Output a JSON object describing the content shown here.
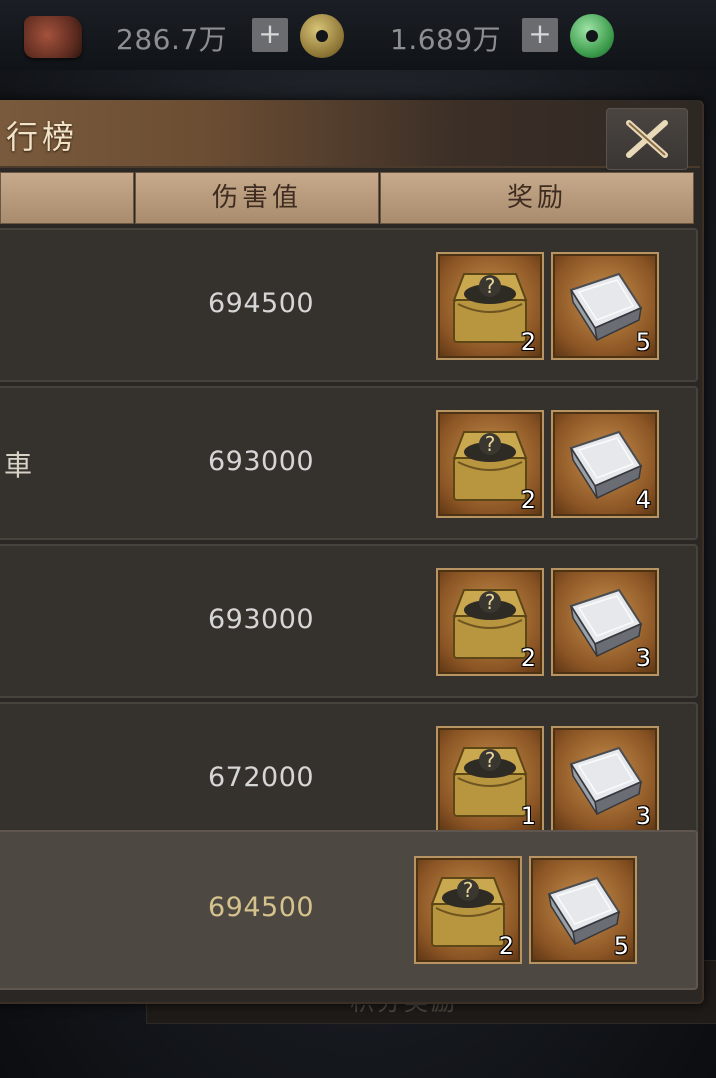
{
  "currency": {
    "copper": {
      "value": "286.7万",
      "icon": "copper-coin-icon"
    },
    "jade": {
      "value": "1.689万",
      "icon": "jade-coin-icon"
    },
    "plus_label": "+"
  },
  "panel": {
    "title": "行榜",
    "close_icon": "close-x-icon",
    "columns": {
      "damage": "伤害值",
      "reward": "奖励"
    },
    "footer_tab": "积分奖励"
  },
  "rankings": [
    {
      "name": "",
      "damage": "694500",
      "rewards": [
        {
          "icon": "treasure-chest-icon",
          "qty": "2"
        },
        {
          "icon": "silver-ingot-icon",
          "qty": "5"
        }
      ]
    },
    {
      "name": "車",
      "damage": "693000",
      "rewards": [
        {
          "icon": "treasure-chest-icon",
          "qty": "2"
        },
        {
          "icon": "silver-ingot-icon",
          "qty": "4"
        }
      ]
    },
    {
      "name": "",
      "damage": "693000",
      "rewards": [
        {
          "icon": "treasure-chest-icon",
          "qty": "2"
        },
        {
          "icon": "silver-ingot-icon",
          "qty": "3"
        }
      ]
    },
    {
      "name": "",
      "damage": "672000",
      "rewards": [
        {
          "icon": "treasure-chest-icon",
          "qty": "1"
        },
        {
          "icon": "silver-ingot-icon",
          "qty": "3"
        }
      ]
    }
  ],
  "self_row": {
    "damage": "694500",
    "rewards": [
      {
        "icon": "treasure-chest-icon",
        "qty": "2"
      },
      {
        "icon": "silver-ingot-icon",
        "qty": "5"
      }
    ]
  },
  "colors": {
    "accent_gold": "#d5c28c",
    "header_tan": "#c7a98b",
    "frame_gold": "#b99463"
  }
}
